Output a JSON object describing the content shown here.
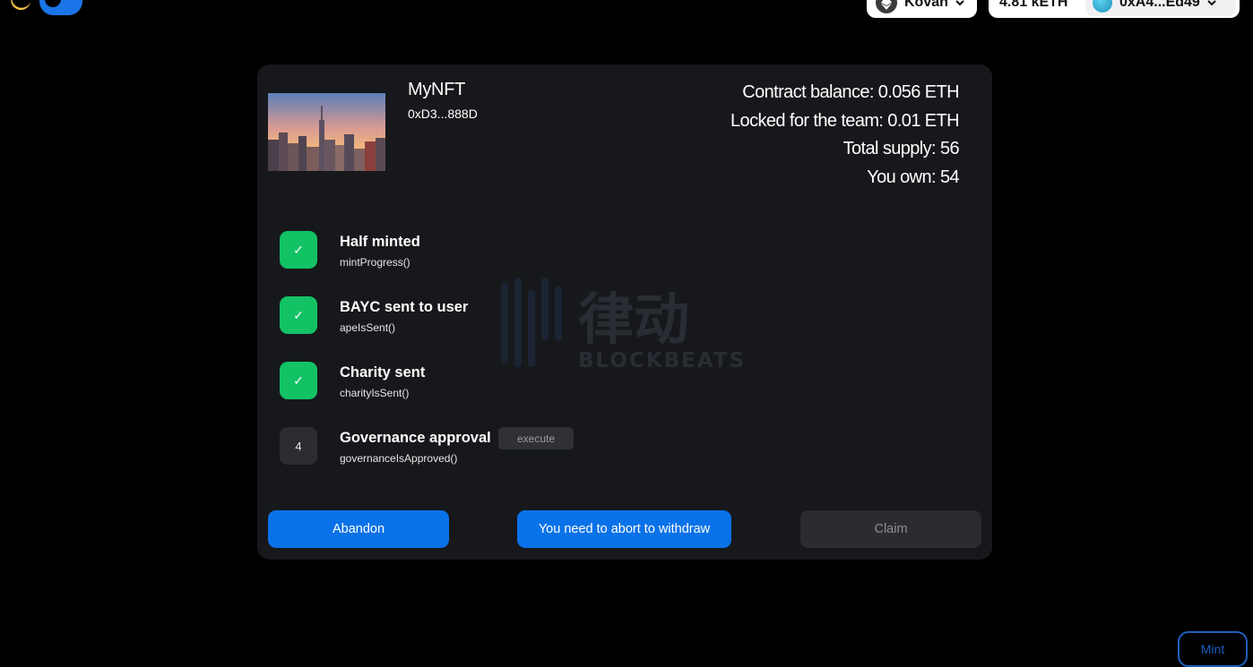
{
  "header": {
    "theme_toggle": {
      "moon_icon": "moon-icon",
      "state": "dark"
    },
    "network": {
      "label": "Kovan",
      "icon": "ethereum-icon"
    },
    "wallet": {
      "balance": "4.81 kETH",
      "address": "0xA4...Ed49"
    }
  },
  "nft": {
    "name": "MyNFT",
    "address": "0xD3...888D",
    "image_icon": "city-skyline-image"
  },
  "stats": {
    "contract_balance": "Contract balance: 0.056 ETH",
    "locked": "Locked for the team: 0.01 ETH",
    "total_supply": "Total supply: 56",
    "you_own": "You own: 54"
  },
  "steps": [
    {
      "badge": "✓",
      "title": "Half minted",
      "fn": "mintProgress()",
      "done": true
    },
    {
      "badge": "✓",
      "title": "BAYC sent to user",
      "fn": "apeIsSent()",
      "done": true
    },
    {
      "badge": "✓",
      "title": "Charity sent",
      "fn": "charityIsSent()",
      "done": true
    },
    {
      "badge": "4",
      "title": "Governance approval",
      "fn": "governanceIsApproved()",
      "done": false,
      "action": "execute"
    }
  ],
  "watermark": {
    "brand": "BLOCKBEATS",
    "cjk": "律动"
  },
  "actions": {
    "abandon": "Abandon",
    "withdraw": "You need to abort to withdraw",
    "claim": "Claim"
  },
  "mint": {
    "label": "Mint"
  },
  "colors": {
    "accent": "#0a72e8",
    "success": "#12c265",
    "card": "#17181b"
  }
}
